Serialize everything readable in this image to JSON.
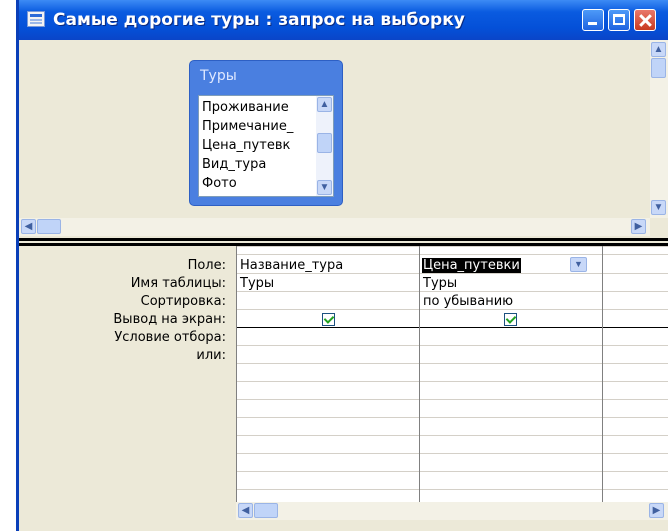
{
  "window": {
    "title": "Самые дорогие туры : запрос на выборку"
  },
  "table_box": {
    "title": "Туры",
    "fields": [
      "Проживание",
      "Примечание_",
      "Цена_путевк",
      "Вид_тура",
      "Фото"
    ]
  },
  "grid": {
    "row_labels": [
      "Поле:",
      "Имя таблицы:",
      "Сортировка:",
      "Вывод на экран:",
      "Условие отбора:",
      "или:"
    ],
    "columns": [
      {
        "field": "Название_тура",
        "table": "Туры",
        "sort": "",
        "show": true
      },
      {
        "field": "Цена_путевки",
        "table": "Туры",
        "sort": "по убыванию",
        "show": true
      }
    ]
  },
  "icons": [
    "window-icon",
    "minimize-icon",
    "maximize-icon",
    "close-icon",
    "scroll-up-icon",
    "scroll-down-icon",
    "scroll-left-icon",
    "scroll-right-icon",
    "dropdown-icon",
    "checkbox-icon"
  ],
  "colors": {
    "titlebar": "#0a5be0",
    "table_box": "#4a7fe0",
    "pane": "#ece9d8"
  }
}
